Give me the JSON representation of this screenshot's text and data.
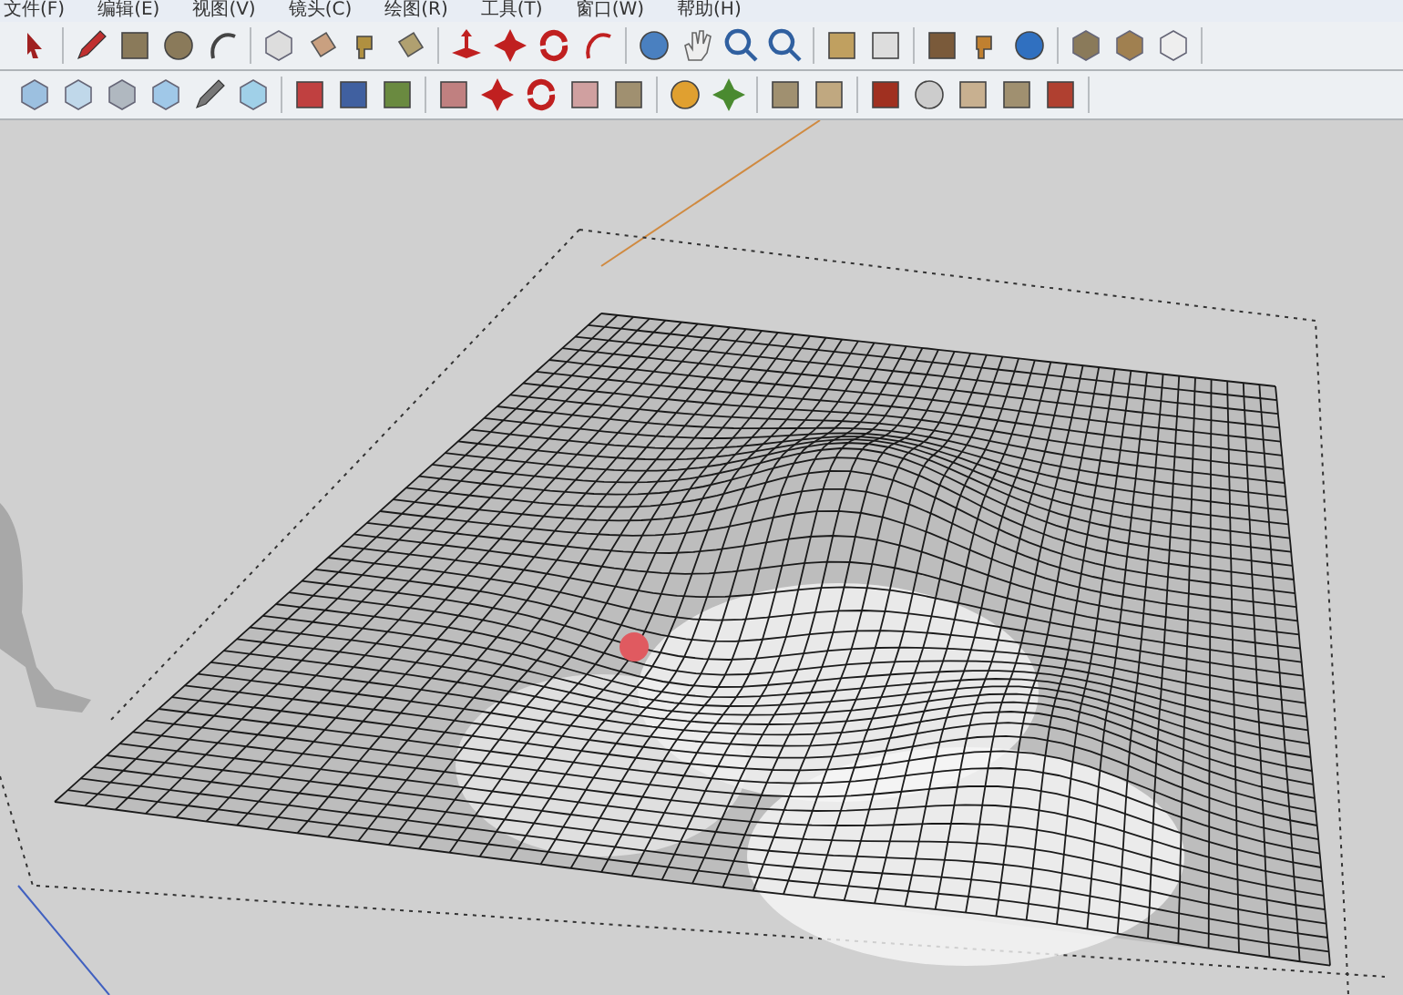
{
  "menu_bar": [
    "文件(F)",
    "编辑(E)",
    "视图(V)",
    "镜头(C)",
    "绘图(R)",
    "工具(T)",
    "窗口(W)",
    "帮助(H)"
  ]
}
